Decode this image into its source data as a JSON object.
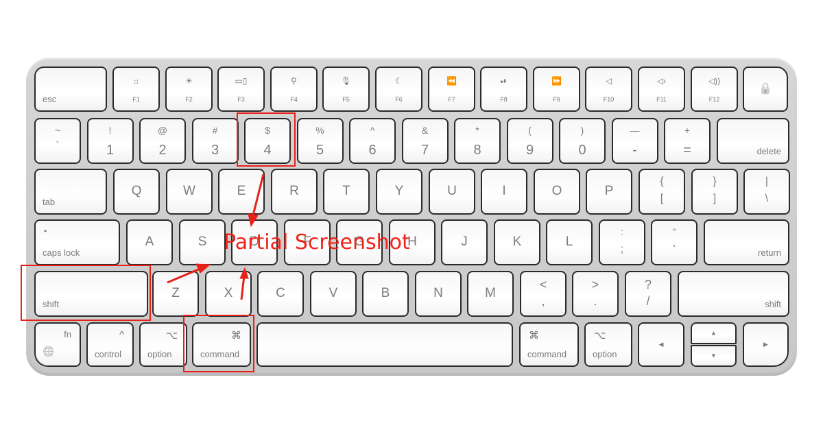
{
  "image": {
    "subject": "Apple Magic Keyboard (compact) with annotations",
    "key_color": "#ffffff",
    "body_color": "#d0d0d0",
    "annotation_color": "#e8201a"
  },
  "rows": {
    "function": [
      {
        "name": "esc",
        "label": "esc"
      },
      {
        "name": "f1",
        "icon": "brightness-down-icon",
        "glyph": "☼",
        "label": "F1"
      },
      {
        "name": "f2",
        "icon": "brightness-up-icon",
        "glyph": "☀",
        "label": "F2"
      },
      {
        "name": "f3",
        "icon": "mission-control-icon",
        "glyph": "▭▯",
        "label": "F3"
      },
      {
        "name": "f4",
        "icon": "search-icon",
        "glyph": "⚲",
        "label": "F4"
      },
      {
        "name": "f5",
        "icon": "microphone-icon",
        "glyph": "🎙",
        "label": "F5"
      },
      {
        "name": "f6",
        "icon": "moon-icon",
        "glyph": "☾",
        "label": "F6"
      },
      {
        "name": "f7",
        "icon": "rewind-icon",
        "glyph": "⏪",
        "label": "F7"
      },
      {
        "name": "f8",
        "icon": "play-pause-icon",
        "glyph": "⏯",
        "label": "F8"
      },
      {
        "name": "f9",
        "icon": "fast-forward-icon",
        "glyph": "⏩",
        "label": "F9"
      },
      {
        "name": "f10",
        "icon": "mute-icon",
        "glyph": "◁",
        "label": "F10"
      },
      {
        "name": "f11",
        "icon": "volume-down-icon",
        "glyph": "◁›",
        "label": "F11"
      },
      {
        "name": "f12",
        "icon": "volume-up-icon",
        "glyph": "◁))",
        "label": "F12"
      },
      {
        "name": "lock",
        "icon": "lock-icon",
        "glyph": "🔒"
      }
    ],
    "number": [
      {
        "top": "~",
        "bottom": "`"
      },
      {
        "top": "!",
        "bottom": "1"
      },
      {
        "top": "@",
        "bottom": "2"
      },
      {
        "top": "#",
        "bottom": "3"
      },
      {
        "top": "$",
        "bottom": "4"
      },
      {
        "top": "%",
        "bottom": "5"
      },
      {
        "top": "^",
        "bottom": "6"
      },
      {
        "top": "&",
        "bottom": "7"
      },
      {
        "top": "*",
        "bottom": "8"
      },
      {
        "top": "(",
        "bottom": "9"
      },
      {
        "top": ")",
        "bottom": "0"
      },
      {
        "top": "—",
        "bottom": "-"
      },
      {
        "top": "+",
        "bottom": "="
      },
      {
        "label": "delete"
      }
    ],
    "top": [
      {
        "label": "tab"
      },
      {
        "letter": "Q"
      },
      {
        "letter": "W"
      },
      {
        "letter": "E"
      },
      {
        "letter": "R"
      },
      {
        "letter": "T"
      },
      {
        "letter": "Y"
      },
      {
        "letter": "U"
      },
      {
        "letter": "I"
      },
      {
        "letter": "O"
      },
      {
        "letter": "P"
      },
      {
        "top": "{",
        "bottom": "["
      },
      {
        "top": "}",
        "bottom": "]"
      },
      {
        "top": "|",
        "bottom": "\\"
      }
    ],
    "home": [
      {
        "label": "caps lock",
        "indicator": "•"
      },
      {
        "letter": "A"
      },
      {
        "letter": "S"
      },
      {
        "letter": "D"
      },
      {
        "letter": "F"
      },
      {
        "letter": "G"
      },
      {
        "letter": "H"
      },
      {
        "letter": "J"
      },
      {
        "letter": "K"
      },
      {
        "letter": "L"
      },
      {
        "top": ":",
        "bottom": ";"
      },
      {
        "top": "\"",
        "bottom": "'"
      },
      {
        "label": "return"
      }
    ],
    "bottom": [
      {
        "label": "shift"
      },
      {
        "letter": "Z"
      },
      {
        "letter": "X"
      },
      {
        "letter": "C"
      },
      {
        "letter": "V"
      },
      {
        "letter": "B"
      },
      {
        "letter": "N"
      },
      {
        "letter": "M"
      },
      {
        "top": "<",
        "bottom": ","
      },
      {
        "top": ">",
        "bottom": "."
      },
      {
        "top": "?",
        "bottom": "/"
      },
      {
        "label": "shift"
      }
    ],
    "modifiers": {
      "fn": {
        "label": "fn",
        "icon": "globe-icon",
        "glyph": "🌐"
      },
      "control_left": {
        "label": "control",
        "symbol": "^"
      },
      "option_left": {
        "label": "option",
        "symbol": "⌥"
      },
      "command_left": {
        "label": "command",
        "symbol": "⌘"
      },
      "command_right": {
        "label": "command",
        "symbol": "⌘"
      },
      "option_right": {
        "label": "option",
        "symbol": "⌥"
      },
      "arrow_left": {
        "glyph": "◀"
      },
      "arrow_up": {
        "glyph": "▲"
      },
      "arrow_down": {
        "glyph": "▼"
      },
      "arrow_right": {
        "glyph": "▶"
      }
    }
  },
  "annotation": {
    "text": "Partial Screenshot",
    "highlighted_keys": [
      "4",
      "shift",
      "command"
    ]
  }
}
